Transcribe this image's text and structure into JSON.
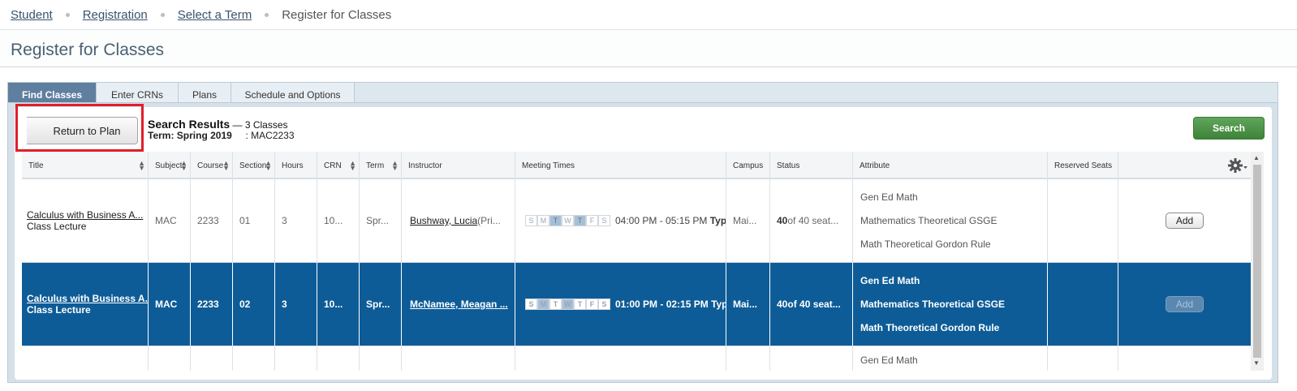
{
  "breadcrumb": [
    "Student",
    "Registration",
    "Select a Term",
    "Register for Classes"
  ],
  "page_title": "Register for Classes",
  "tabs": [
    "Find Classes",
    "Enter CRNs",
    "Plans",
    "Schedule and Options"
  ],
  "actions": {
    "return_label": "Return to Plan",
    "search_label": "Search"
  },
  "results": {
    "heading": "Search Results",
    "count": " — 3 Classes",
    "term": "Term: Spring 2019",
    "course": ": MAC2233"
  },
  "columns": [
    "Title",
    "Subject",
    "Course",
    "Section",
    "Hours",
    "CRN",
    "Term",
    "Instructor",
    "Meeting Times",
    "Campus",
    "Status",
    "Attribute",
    "Reserved Seats"
  ],
  "rows": [
    {
      "title": "Calculus with Business A...",
      "subtitle": "Class Lecture",
      "subject": "MAC",
      "course": "2233",
      "section": "01",
      "hours": "3",
      "crn": "10...",
      "term": "Spr...",
      "instructor": "Bushway, Lucia",
      "instructor_role": " (Pri...",
      "time": "04:00 PM - 05:15 PM",
      "time_type": "Type",
      "campus": "Mai...",
      "status_count": "40",
      "status_rest": " of 40 seat...",
      "attributes": [
        "Gen Ed Math",
        "Mathematics Theoretical GSGE",
        "Math Theoretical Gordon Rule"
      ],
      "add_label": "Add"
    },
    {
      "title": "Calculus with Business A...",
      "subtitle": "Class Lecture",
      "subject": "MAC",
      "course": "2233",
      "section": "02",
      "hours": "3",
      "crn": "10...",
      "term": "Spr...",
      "instructor": "McNamee, Meagan ...",
      "instructor_role": "",
      "time": "01:00 PM - 02:15 PM",
      "time_type": "Type",
      "campus": "Mai...",
      "status_count": "40",
      "status_rest": " of 40 seat...",
      "attributes": [
        "Gen Ed Math",
        "Mathematics Theoretical GSGE",
        "Math Theoretical Gordon Rule"
      ],
      "add_label": "Add"
    },
    {
      "attributes": [
        "Gen Ed Math"
      ]
    }
  ],
  "days": [
    "S",
    "M",
    "T",
    "W",
    "T",
    "F",
    "S"
  ],
  "icons": {
    "gear": "gear-icon",
    "sort": "sort-icon",
    "return_arrow": "back-arrow-icon"
  },
  "colors": {
    "selected_row": "#0e5c97",
    "search_button": "#4a8f44",
    "highlight": "#e21d2a",
    "active_tab": "#5f7f9e"
  }
}
